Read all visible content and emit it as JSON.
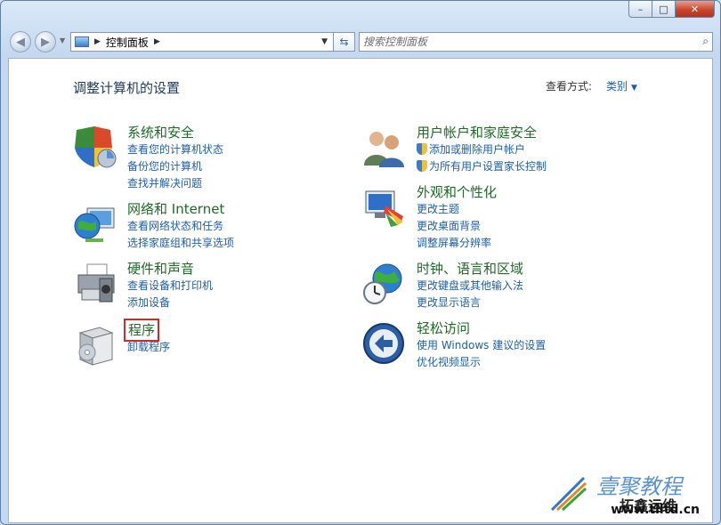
{
  "window": {
    "caption_buttons": {
      "minimize": "–",
      "maximize": "□",
      "close": "✕"
    }
  },
  "navbar": {
    "back_icon": "back-arrow-icon",
    "forward_icon": "forward-arrow-icon",
    "address": {
      "crumb": "控制面板",
      "separator": "▶"
    },
    "refresh_icon": "refresh-icon",
    "search": {
      "placeholder": "搜索控制面板"
    }
  },
  "page": {
    "title": "调整计算机的设置",
    "view_by_label": "查看方式:",
    "view_by_value": "类别"
  },
  "categories": [
    {
      "title": "系统和安全",
      "icon": "system-security-icon",
      "links": [
        "查看您的计算机状态",
        "备份您的计算机",
        "查找并解决问题"
      ]
    },
    {
      "title": "网络和 Internet",
      "icon": "network-globe-icon",
      "links": [
        "查看网络状态和任务",
        "选择家庭组和共享选项"
      ]
    },
    {
      "title": "硬件和声音",
      "icon": "printer-hardware-icon",
      "links": [
        "查看设备和打印机",
        "添加设备"
      ]
    },
    {
      "title": "程序",
      "icon": "programs-box-icon",
      "links": [
        "卸载程序"
      ]
    },
    {
      "title": "用户帐户和家庭安全",
      "icon": "users-icon",
      "links": [
        "添加或删除用户帐户",
        "为所有用户设置家长控制"
      ]
    },
    {
      "title": "外观和个性化",
      "icon": "appearance-monitor-icon",
      "links": [
        "更改主题",
        "更改桌面背景",
        "调整屏幕分辨率"
      ]
    },
    {
      "title": "时钟、语言和区域",
      "icon": "clock-globe-icon",
      "links": [
        "更改键盘或其他输入法",
        "更改显示语言"
      ]
    },
    {
      "title": "轻松访问",
      "icon": "ease-of-access-icon",
      "links": [
        "使用 Windows 建议的设置",
        "优化视频显示"
      ]
    }
  ],
  "watermark": {
    "line1": "壹聚教程",
    "line2": "拓鑫运维",
    "url": "www.tlltd.cn"
  },
  "colors": {
    "category_title": "#1e6b25",
    "link": "#1e5fa8",
    "highlight": "#cf2a2a"
  }
}
